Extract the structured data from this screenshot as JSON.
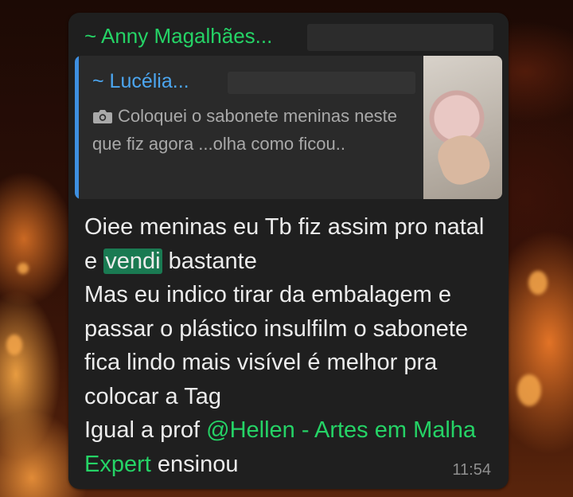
{
  "message": {
    "sender": "~ Anny Magalhães...",
    "quoted": {
      "author": "~ Lucélia...",
      "text": "Coloquei o sabonete meninas neste que fiz agora ...olha como ficou..",
      "thumbnail_icon": "camera-icon"
    },
    "body": {
      "part1": "Oiee meninas eu Tb fiz assim pro natal e ",
      "highlight": "vendi",
      "part2": " bastante",
      "line3": "Mas eu indico tirar da embalagem e passar o plástico insulfilm o sabonete fica lindo mais visível é melhor pra colocar a Tag",
      "line4_prefix": "Igual a prof ",
      "mention": "@Hellen - Artes em Malha Expert",
      "line4_suffix": " ensinou"
    },
    "time": "11:54"
  },
  "colors": {
    "sender": "#25d366",
    "quoted_author": "#4ca6f0",
    "highlight_bg": "#1a7a52",
    "bubble_bg": "#1f1f1f"
  }
}
